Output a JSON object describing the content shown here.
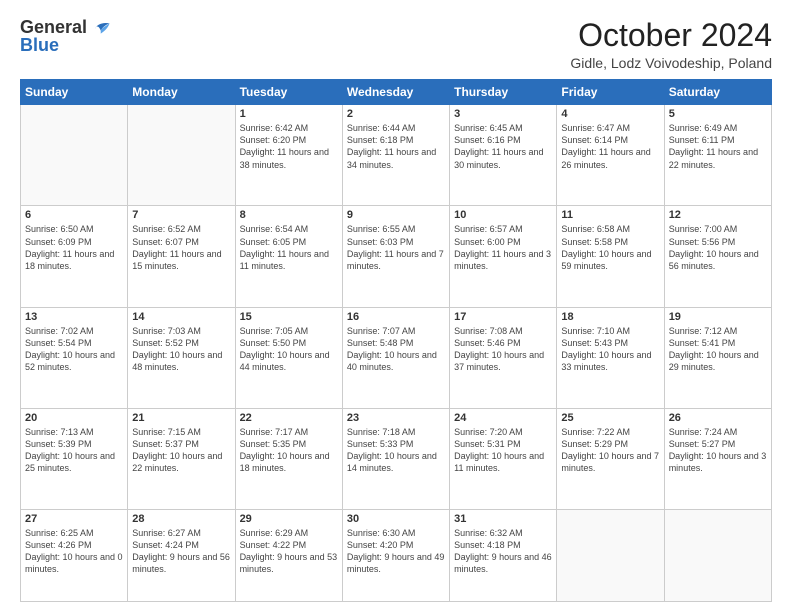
{
  "header": {
    "logo_general": "General",
    "logo_blue": "Blue",
    "month_title": "October 2024",
    "location": "Gidle, Lodz Voivodeship, Poland"
  },
  "days_of_week": [
    "Sunday",
    "Monday",
    "Tuesday",
    "Wednesday",
    "Thursday",
    "Friday",
    "Saturday"
  ],
  "weeks": [
    [
      {
        "day": "",
        "info": ""
      },
      {
        "day": "",
        "info": ""
      },
      {
        "day": "1",
        "info": "Sunrise: 6:42 AM\nSunset: 6:20 PM\nDaylight: 11 hours and 38 minutes."
      },
      {
        "day": "2",
        "info": "Sunrise: 6:44 AM\nSunset: 6:18 PM\nDaylight: 11 hours and 34 minutes."
      },
      {
        "day": "3",
        "info": "Sunrise: 6:45 AM\nSunset: 6:16 PM\nDaylight: 11 hours and 30 minutes."
      },
      {
        "day": "4",
        "info": "Sunrise: 6:47 AM\nSunset: 6:14 PM\nDaylight: 11 hours and 26 minutes."
      },
      {
        "day": "5",
        "info": "Sunrise: 6:49 AM\nSunset: 6:11 PM\nDaylight: 11 hours and 22 minutes."
      }
    ],
    [
      {
        "day": "6",
        "info": "Sunrise: 6:50 AM\nSunset: 6:09 PM\nDaylight: 11 hours and 18 minutes."
      },
      {
        "day": "7",
        "info": "Sunrise: 6:52 AM\nSunset: 6:07 PM\nDaylight: 11 hours and 15 minutes."
      },
      {
        "day": "8",
        "info": "Sunrise: 6:54 AM\nSunset: 6:05 PM\nDaylight: 11 hours and 11 minutes."
      },
      {
        "day": "9",
        "info": "Sunrise: 6:55 AM\nSunset: 6:03 PM\nDaylight: 11 hours and 7 minutes."
      },
      {
        "day": "10",
        "info": "Sunrise: 6:57 AM\nSunset: 6:00 PM\nDaylight: 11 hours and 3 minutes."
      },
      {
        "day": "11",
        "info": "Sunrise: 6:58 AM\nSunset: 5:58 PM\nDaylight: 10 hours and 59 minutes."
      },
      {
        "day": "12",
        "info": "Sunrise: 7:00 AM\nSunset: 5:56 PM\nDaylight: 10 hours and 56 minutes."
      }
    ],
    [
      {
        "day": "13",
        "info": "Sunrise: 7:02 AM\nSunset: 5:54 PM\nDaylight: 10 hours and 52 minutes."
      },
      {
        "day": "14",
        "info": "Sunrise: 7:03 AM\nSunset: 5:52 PM\nDaylight: 10 hours and 48 minutes."
      },
      {
        "day": "15",
        "info": "Sunrise: 7:05 AM\nSunset: 5:50 PM\nDaylight: 10 hours and 44 minutes."
      },
      {
        "day": "16",
        "info": "Sunrise: 7:07 AM\nSunset: 5:48 PM\nDaylight: 10 hours and 40 minutes."
      },
      {
        "day": "17",
        "info": "Sunrise: 7:08 AM\nSunset: 5:46 PM\nDaylight: 10 hours and 37 minutes."
      },
      {
        "day": "18",
        "info": "Sunrise: 7:10 AM\nSunset: 5:43 PM\nDaylight: 10 hours and 33 minutes."
      },
      {
        "day": "19",
        "info": "Sunrise: 7:12 AM\nSunset: 5:41 PM\nDaylight: 10 hours and 29 minutes."
      }
    ],
    [
      {
        "day": "20",
        "info": "Sunrise: 7:13 AM\nSunset: 5:39 PM\nDaylight: 10 hours and 25 minutes."
      },
      {
        "day": "21",
        "info": "Sunrise: 7:15 AM\nSunset: 5:37 PM\nDaylight: 10 hours and 22 minutes."
      },
      {
        "day": "22",
        "info": "Sunrise: 7:17 AM\nSunset: 5:35 PM\nDaylight: 10 hours and 18 minutes."
      },
      {
        "day": "23",
        "info": "Sunrise: 7:18 AM\nSunset: 5:33 PM\nDaylight: 10 hours and 14 minutes."
      },
      {
        "day": "24",
        "info": "Sunrise: 7:20 AM\nSunset: 5:31 PM\nDaylight: 10 hours and 11 minutes."
      },
      {
        "day": "25",
        "info": "Sunrise: 7:22 AM\nSunset: 5:29 PM\nDaylight: 10 hours and 7 minutes."
      },
      {
        "day": "26",
        "info": "Sunrise: 7:24 AM\nSunset: 5:27 PM\nDaylight: 10 hours and 3 minutes."
      }
    ],
    [
      {
        "day": "27",
        "info": "Sunrise: 6:25 AM\nSunset: 4:26 PM\nDaylight: 10 hours and 0 minutes."
      },
      {
        "day": "28",
        "info": "Sunrise: 6:27 AM\nSunset: 4:24 PM\nDaylight: 9 hours and 56 minutes."
      },
      {
        "day": "29",
        "info": "Sunrise: 6:29 AM\nSunset: 4:22 PM\nDaylight: 9 hours and 53 minutes."
      },
      {
        "day": "30",
        "info": "Sunrise: 6:30 AM\nSunset: 4:20 PM\nDaylight: 9 hours and 49 minutes."
      },
      {
        "day": "31",
        "info": "Sunrise: 6:32 AM\nSunset: 4:18 PM\nDaylight: 9 hours and 46 minutes."
      },
      {
        "day": "",
        "info": ""
      },
      {
        "day": "",
        "info": ""
      }
    ]
  ]
}
